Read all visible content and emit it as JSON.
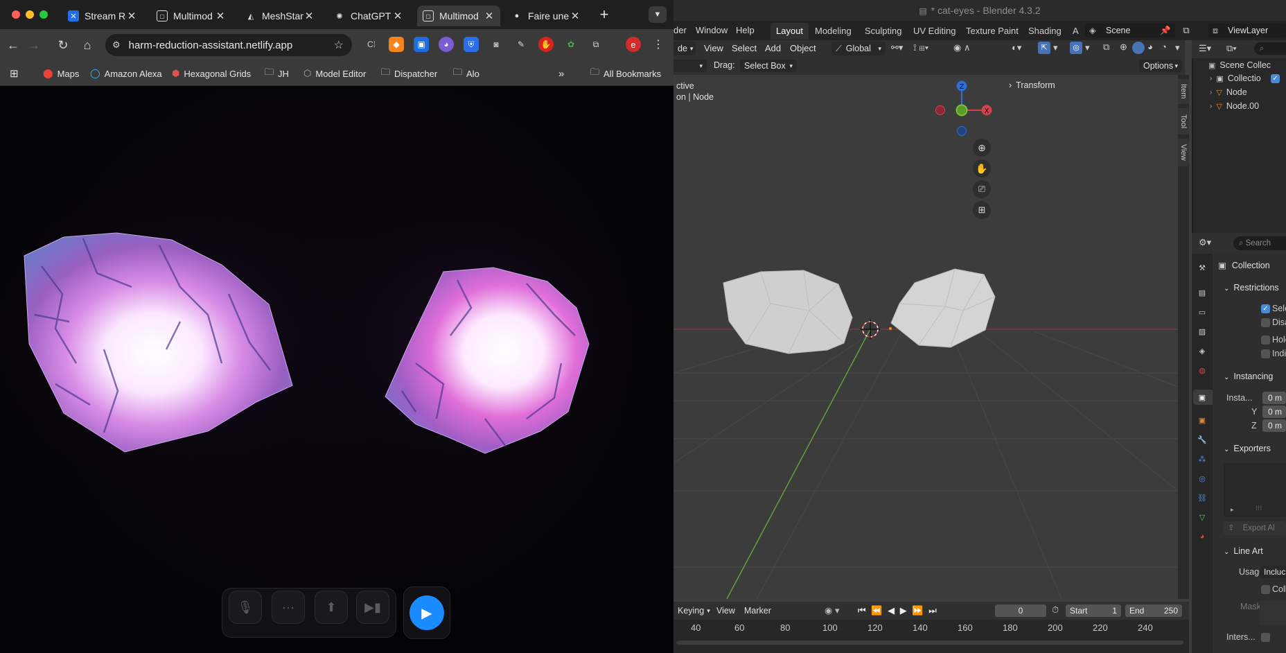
{
  "browser": {
    "tabs": [
      {
        "title": "Stream Re",
        "icon": "stream-icon"
      },
      {
        "title": "Multimod",
        "icon": "doc-icon"
      },
      {
        "title": "MeshStan",
        "icon": "mesh-icon"
      },
      {
        "title": "ChatGPT",
        "icon": "chatgpt-icon"
      },
      {
        "title": "Multimod",
        "icon": "doc-icon",
        "active": true
      },
      {
        "title": "Faire une",
        "icon": "apple-icon"
      }
    ],
    "new_tab": "+",
    "url": "harm-reduction-assistant.netlify.app",
    "bookmarks": [
      {
        "label": "Maps",
        "icon": "maps-pin-icon"
      },
      {
        "label": "Amazon Alexa",
        "icon": "alexa-icon"
      },
      {
        "label": "Hexagonal Grids",
        "icon": "hexagon-icon"
      },
      {
        "label": "JH",
        "icon": "folder-icon"
      },
      {
        "label": "Model Editor",
        "icon": "cube-icon"
      },
      {
        "label": "Dispatcher",
        "icon": "folder-icon"
      },
      {
        "label": "Alo",
        "icon": "folder-icon"
      }
    ],
    "more_bookmarks": "»",
    "all_bookmarks": "All Bookmarks",
    "profile_initial": "e",
    "colors": {
      "play_button": "#1a8cff",
      "profile": "#d42c2c"
    }
  },
  "blender": {
    "title": "* cat-eyes - Blender 4.3.2",
    "menu": [
      "der",
      "Window",
      "Help"
    ],
    "workspaces": [
      "Layout",
      "Modeling",
      "Sculpting",
      "UV Editing",
      "Texture Paint",
      "Shading",
      "A"
    ],
    "active_workspace": "Layout",
    "scene": "Scene",
    "view_layer": "ViewLayer",
    "viewport_menu": [
      "de",
      "View",
      "Select",
      "Add",
      "Object"
    ],
    "orientation": "Global",
    "drag_label": "Drag:",
    "drag_value": "Select Box",
    "options": "Options",
    "overlay_text1": "ctive",
    "overlay_text2": "on | Node",
    "npanel_section": "Transform",
    "npanel_tabs": [
      "Item",
      "Tool",
      "View"
    ],
    "gizmo": {
      "z": "Z",
      "x": "X"
    },
    "timeline": {
      "menu": [
        "Keying",
        "View",
        "Marker"
      ],
      "current_frame": "0",
      "start_label": "Start",
      "start": "1",
      "end_label": "End",
      "end": "250",
      "ticks": [
        "40",
        "60",
        "80",
        "100",
        "120",
        "140",
        "160",
        "180",
        "200",
        "220",
        "240"
      ]
    },
    "outliner": {
      "search": "",
      "rows": [
        {
          "label": "Scene Collec",
          "indent": 0
        },
        {
          "label": "Collectio",
          "indent": 1,
          "checked": true
        },
        {
          "label": "Node",
          "indent": 1
        },
        {
          "label": "Node.00",
          "indent": 1
        }
      ]
    },
    "properties": {
      "search": "Search",
      "title": "Collection",
      "sections": {
        "restrictions": "Restrictions",
        "instancing": "Instancing",
        "exporters": "Exporters",
        "line_art": "Line Art"
      },
      "restrictions": [
        {
          "label": "Sele",
          "checked": true
        },
        {
          "label": "Disa",
          "checked": false
        },
        {
          "label": "Holc",
          "checked": false
        },
        {
          "label": "Indi",
          "checked": false
        }
      ],
      "instancing": [
        {
          "label": "Insta...",
          "value": "0 m"
        },
        {
          "label": "Y",
          "value": "0 m"
        },
        {
          "label": "Z",
          "value": "0 m"
        }
      ],
      "export_all": "Export Al",
      "line_art": {
        "usage_label": "Usage",
        "usage_value": "Incluc",
        "coll_label": "Colli",
        "masks_label": "Masks",
        "intersect_label": "Inters..."
      }
    }
  }
}
